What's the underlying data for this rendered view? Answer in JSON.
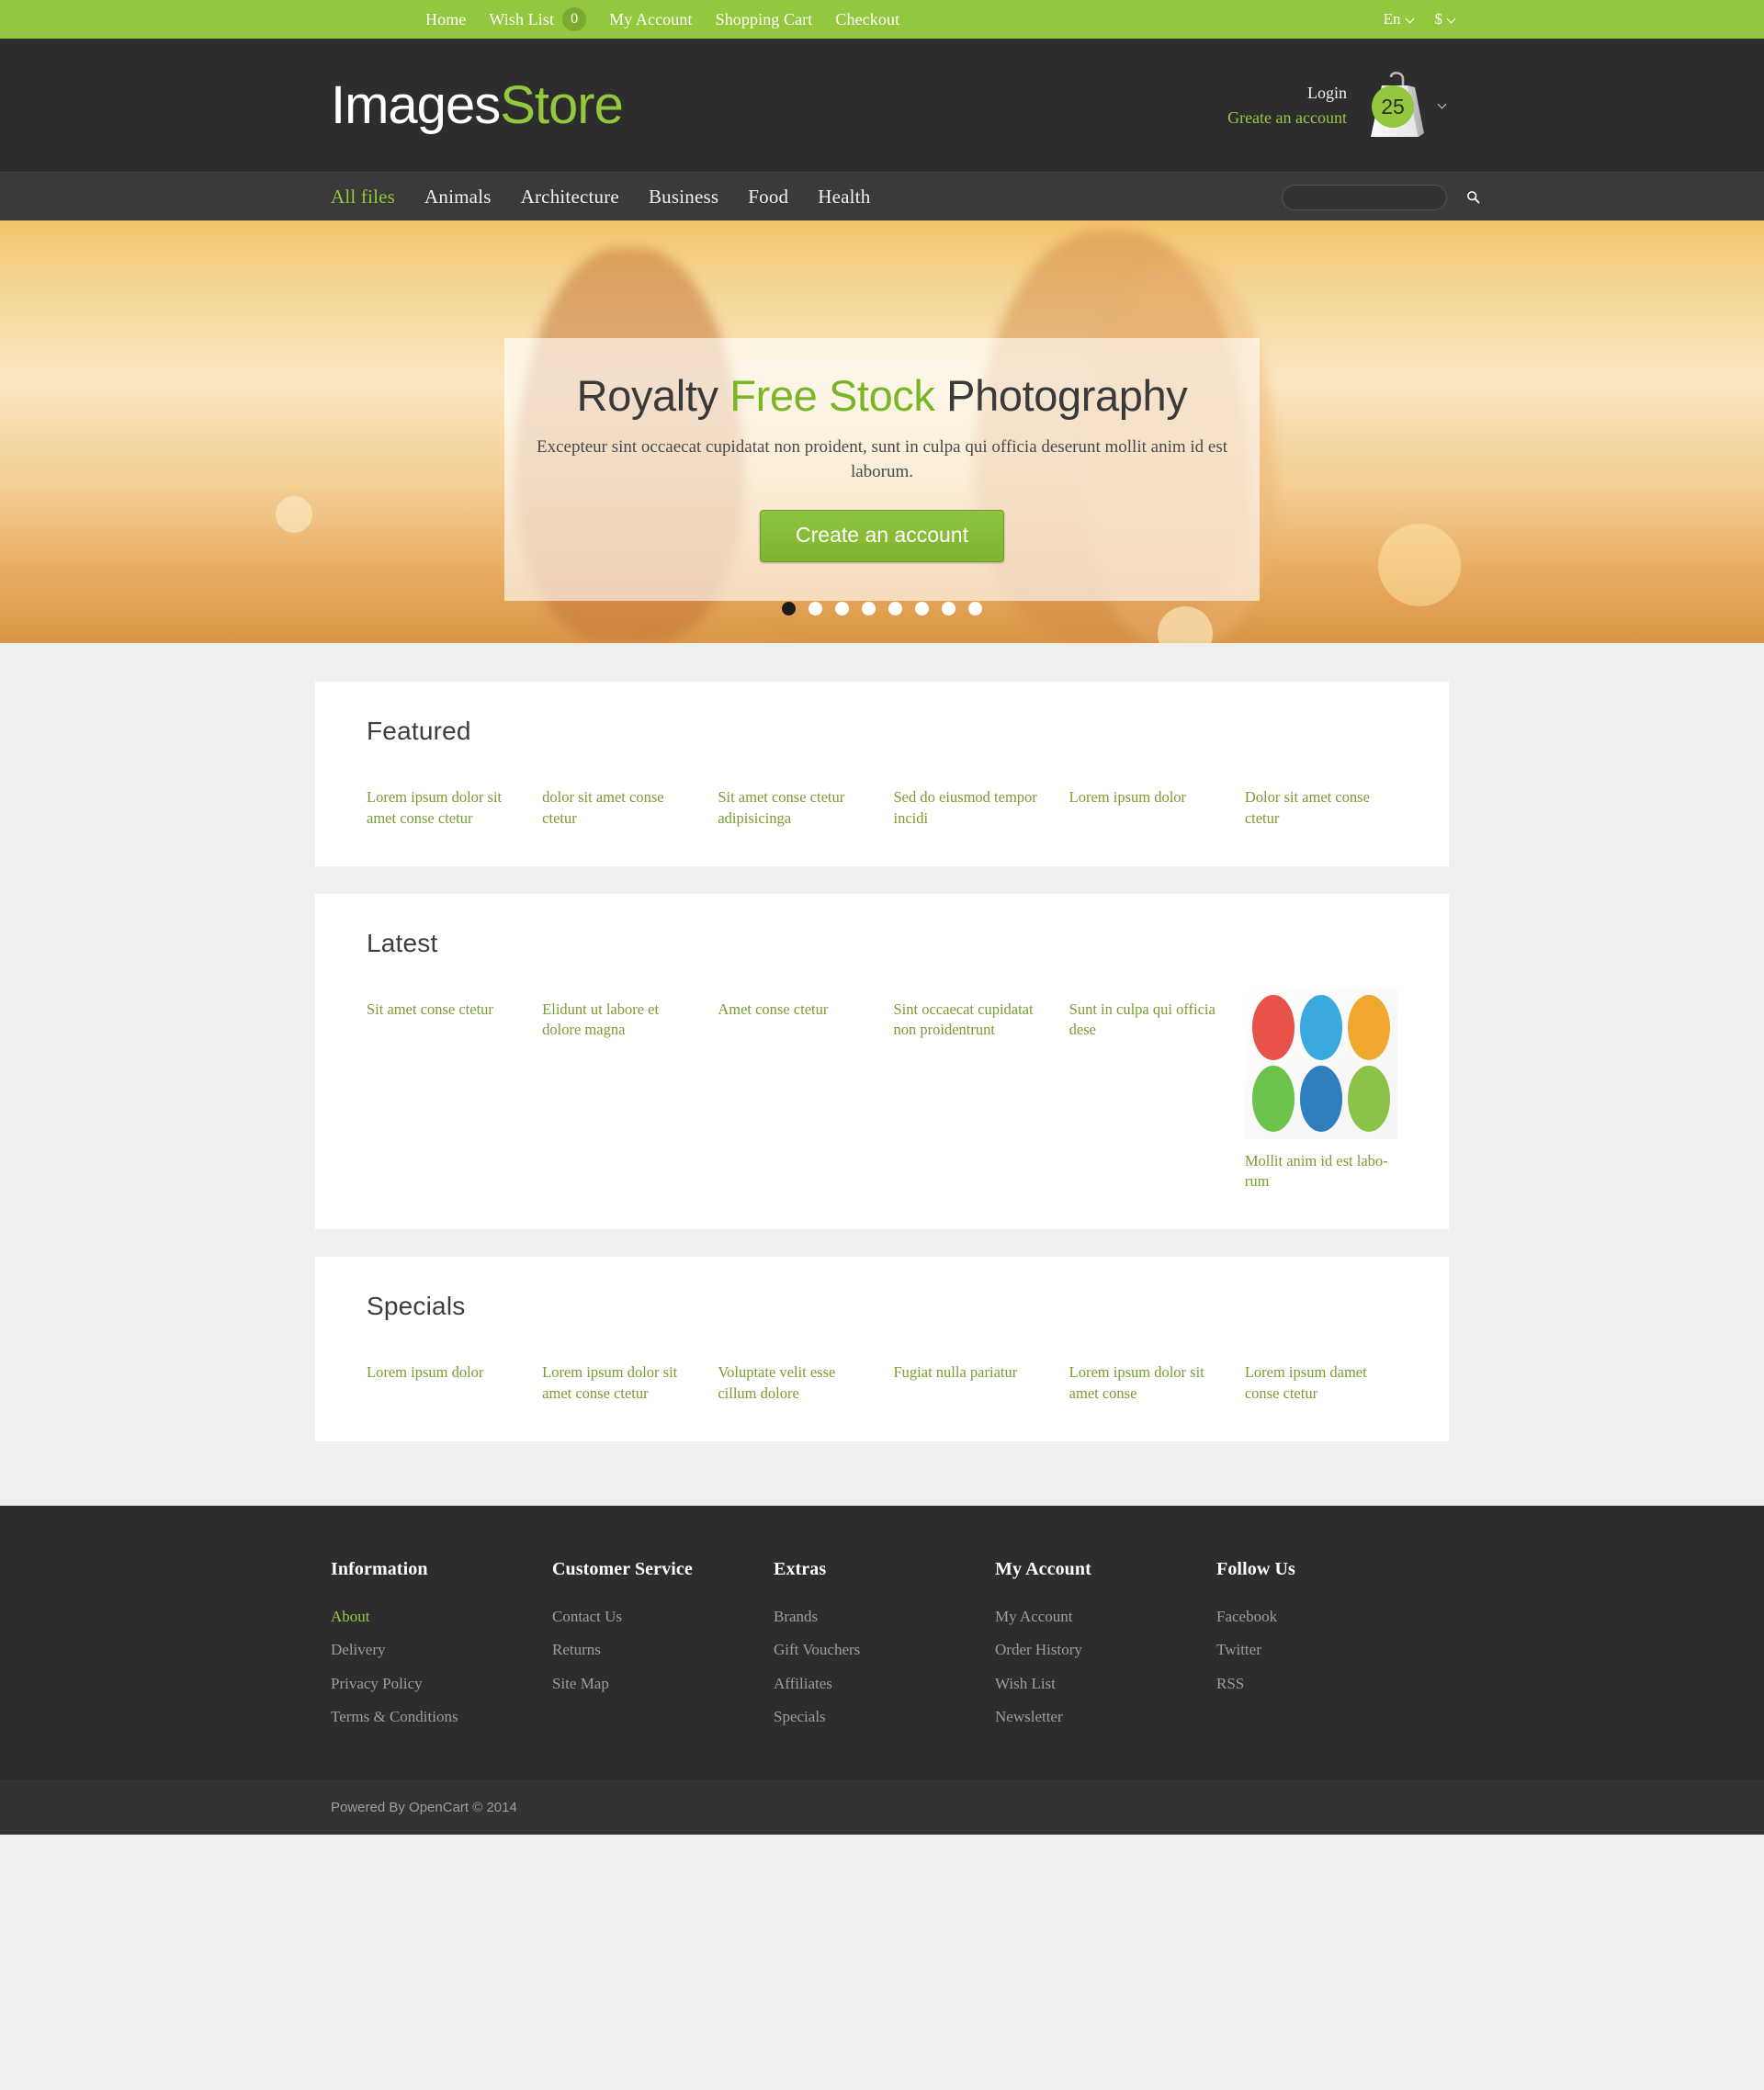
{
  "topbar": {
    "links": [
      {
        "label": "Home",
        "active": true
      },
      {
        "label": "Wish List",
        "count": "0"
      },
      {
        "label": "My Account"
      },
      {
        "label": "Shopping Cart"
      },
      {
        "label": "Checkout"
      }
    ],
    "language": "En",
    "currency": "$"
  },
  "header": {
    "logo_primary": "Images",
    "logo_secondary": "Store",
    "login_label": "Login",
    "create_account_label": "Greate an account",
    "cart_count": "25"
  },
  "nav": {
    "items": [
      {
        "label": "All files",
        "active": true
      },
      {
        "label": "Animals"
      },
      {
        "label": "Architecture"
      },
      {
        "label": "Business"
      },
      {
        "label": "Food"
      },
      {
        "label": "Health"
      }
    ],
    "search_placeholder": "",
    "search_value": ""
  },
  "hero": {
    "title_part1": "Royalty ",
    "title_highlight": "Free Stock",
    "title_part2": " Photography",
    "subtitle": "Excepteur sint occaecat cupidatat non proident, sunt in culpa qui officia deserunt mollit anim id est laborum.",
    "cta_label": "Create an account",
    "dot_count": 8,
    "active_dot": 0
  },
  "sections": [
    {
      "title": "Featured",
      "items": [
        {
          "caption": "Lorem ipsum dolor sit amet conse ctetur",
          "art": "blue-abstract"
        },
        {
          "caption": "dolor sit amet conse ctetur",
          "art": "mask-carnival"
        },
        {
          "caption": "Sit amet conse ctetur adipisicinga",
          "art": "baseball-team"
        },
        {
          "caption": "Sed do eiusmod tempor incidi",
          "art": "woman-headset"
        },
        {
          "caption": "Lorem ipsum dolor",
          "art": "gold-texture"
        },
        {
          "caption": "Dolor sit amet conse ctetur",
          "art": "wedding-couple"
        }
      ]
    },
    {
      "title": "Latest",
      "items": [
        {
          "caption": "Sit amet conse ctetur",
          "art": "brick-arches"
        },
        {
          "caption": "Elidunt ut labore et dolore magna",
          "art": "business-paper"
        },
        {
          "caption": "Amet conse ctetur",
          "art": "man-presenting"
        },
        {
          "caption": "Sint occaecat cupidatat non proidentrunt",
          "art": "couple-beach"
        },
        {
          "caption": "Sunt in culpa qui officia dese",
          "art": "stone-columns"
        },
        {
          "caption": "Mollit anim id est labo-rum",
          "art": "flat-icons"
        }
      ]
    },
    {
      "title": "Specials",
      "items": [
        {
          "caption": "Lorem ipsum dolor",
          "art": "teal-fractal"
        },
        {
          "caption": "Lorem ipsum dolor sit amet conse ctetur",
          "art": "yellow-arches"
        },
        {
          "caption": "Voluptate velit esse cillum dolore",
          "art": "athlete-dark"
        },
        {
          "caption": "Fugiat nulla pariatur",
          "art": "glass-mesh"
        },
        {
          "caption": "Lorem ipsum dolor sit amet conse",
          "art": "brick-wall"
        },
        {
          "caption": "Lorem ipsum damet conse ctetur",
          "art": "business-people"
        }
      ]
    }
  ],
  "footer": {
    "columns": [
      {
        "title": "Information",
        "links": [
          {
            "label": "About",
            "active": true
          },
          {
            "label": "Delivery"
          },
          {
            "label": "Privacy Policy"
          },
          {
            "label": "Terms & Conditions"
          }
        ]
      },
      {
        "title": "Customer Service",
        "links": [
          {
            "label": "Contact Us"
          },
          {
            "label": "Returns"
          },
          {
            "label": "Site Map"
          }
        ]
      },
      {
        "title": "Extras",
        "links": [
          {
            "label": "Brands"
          },
          {
            "label": "Gift Vouchers"
          },
          {
            "label": "Affiliates"
          },
          {
            "label": "Specials"
          }
        ]
      },
      {
        "title": "My Account",
        "links": [
          {
            "label": "My Account"
          },
          {
            "label": "Order History"
          },
          {
            "label": "Wish List"
          },
          {
            "label": "Newsletter"
          }
        ]
      },
      {
        "title": "Follow Us",
        "links": [
          {
            "label": "Facebook"
          },
          {
            "label": "Twitter"
          },
          {
            "label": "RSS"
          }
        ]
      }
    ],
    "copyright": "Powered By OpenCart © 2014"
  },
  "colors": {
    "brand_green": "#93c83e",
    "link_green": "#7a9c32",
    "dark": "#2d2d2d"
  }
}
